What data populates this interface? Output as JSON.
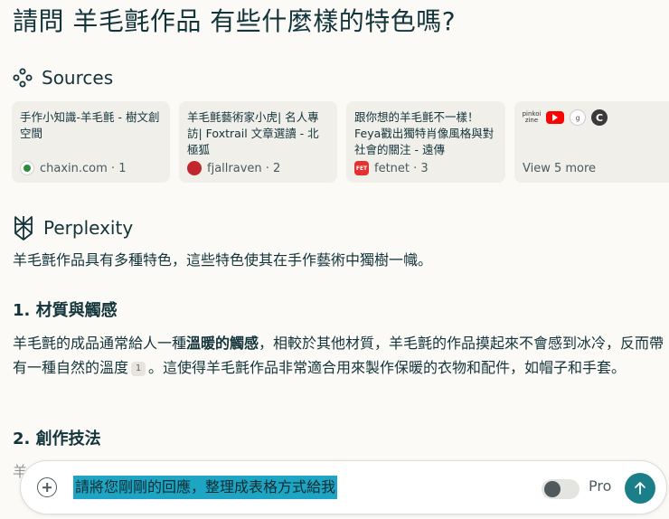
{
  "question": "請問 羊毛氈作品 有些什麼樣的特色嗎?",
  "sources": {
    "header": "Sources",
    "icon": "sources-icon",
    "items": [
      {
        "title": "手作小知識-羊毛氈 - 樹文創空間",
        "site": "chaxin.com · 1",
        "favicon": "chaxin-favicon"
      },
      {
        "title": "羊毛氈藝術家小虎| 名人專訪| Foxtrail 文章選讀 - 北極狐",
        "site": "fjallraven · 2",
        "favicon": "fjallraven-favicon"
      },
      {
        "title": "跟你想的羊毛氈不一樣！Feya戳出獨特肖像風格與對社會的關注 - 遠傳",
        "site": "fetnet · 3",
        "favicon": "fetnet-favicon"
      }
    ],
    "more": {
      "label": "View 5 more",
      "icons": [
        "pinkoi-zine-icon",
        "youtube-icon",
        "g-icon",
        "c-icon"
      ],
      "zine_text": "pinkoi zine",
      "g_text": "g",
      "c_text": "C",
      "fet_text": "FET"
    }
  },
  "answer": {
    "header": "Perplexity",
    "icon": "perplexity-logo-icon",
    "intro": "羊毛氈作品具有多種特色，這些特色使其在手作藝術中獨樹一幟。",
    "section1_title": "1. 材質與觸感",
    "section1_pre": "羊毛氈的成品通常給人一種",
    "section1_bold": "溫暖的觸感",
    "section1_mid": "，相較於其他材質，羊毛氈的作品摸起來不會感到冰冷，反而帶有一種自然的溫度",
    "section1_cite": "1",
    "section1_post": "。這使得羊毛氈作品非常適合用來製作保暖的衣物和配件，如帽子和手套。",
    "section2_title": "2. 創作技法",
    "ghost_text": "羊"
  },
  "composer": {
    "input_value": "請將您剛剛的回應，整理成表格方式給我",
    "pro_label": "Pro",
    "pro_enabled": false
  },
  "colors": {
    "background": "#fbfaf6",
    "text": "#13343b",
    "accent": "#1b7f8a",
    "selection": "#1ea5c4",
    "card": "#f0efea"
  }
}
